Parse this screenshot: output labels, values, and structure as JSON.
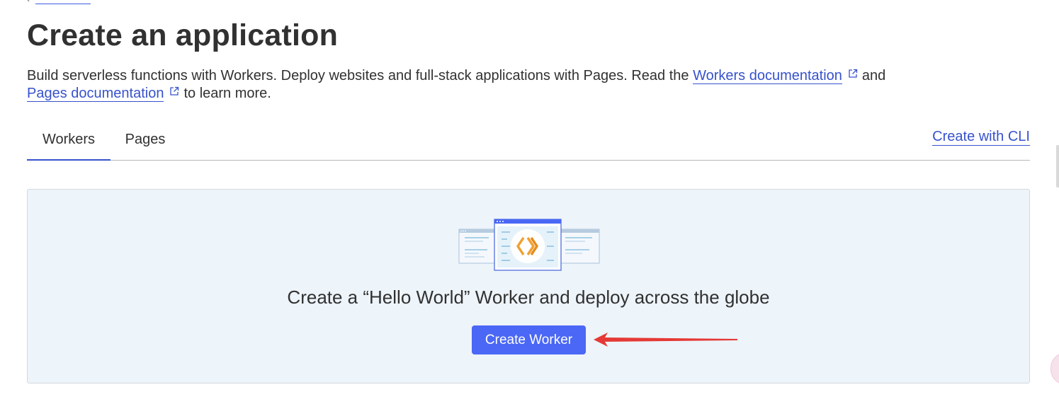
{
  "page": {
    "title": "Create an application",
    "description": {
      "part1": "Build serverless functions with Workers. Deploy websites and full-stack applications with Pages. Read the ",
      "workers_doc_link": "Workers documentation",
      "part2": "and",
      "pages_doc_link": "Pages documentation",
      "part3": "to learn more."
    }
  },
  "tabs": [
    {
      "label": "Workers",
      "active": true
    },
    {
      "label": "Pages",
      "active": false
    }
  ],
  "create_with_cli": "Create with CLI",
  "panel": {
    "heading": "Create a “Hello World” Worker and deploy across the globe",
    "button_label": "Create Worker"
  },
  "icons": {
    "external_link": "external-link-icon",
    "back": "chevron-left-icon",
    "illustration": "worker-windows-illustration",
    "annotation": "red-arrow-annotation"
  },
  "colors": {
    "link": "#3752cc",
    "button": "#4a67f5",
    "panel_bg": "#edf4fa",
    "orange_logo": "#f0a030",
    "arrow": "#e53935"
  }
}
